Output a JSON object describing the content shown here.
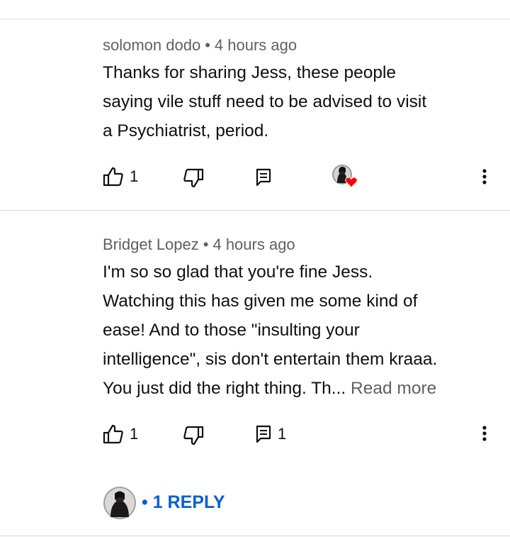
{
  "comments": [
    {
      "author": "solomon dodo",
      "separator": "•",
      "time": "4 hours ago",
      "lines": [
        "Thanks for sharing Jess, these people",
        "saying vile stuff need to be advised to visit",
        "a Psychiatrist, period."
      ],
      "likes": "1",
      "replies_count": ""
    },
    {
      "author": "Bridget Lopez",
      "separator": "•",
      "time": "4 hours ago",
      "lines": [
        "I'm so so glad that you're fine Jess.",
        "Watching this has given me some kind of",
        "ease! And to those \"insulting your",
        "intelligence\", sis don't entertain them kraaa.",
        "You just did the right thing. Th..."
      ],
      "read_more": "Read more",
      "likes": "1",
      "replies_count": "1"
    }
  ],
  "reply_link": "• 1 REPLY",
  "icons": {
    "like": "thumbs-up-icon",
    "dislike": "thumbs-down-icon",
    "reply": "reply-comment-icon",
    "more": "more-vert-icon",
    "heart": "creator-heart-icon"
  },
  "colors": {
    "link": "#065fd4",
    "meta": "#606060",
    "heart": "#ff0000"
  }
}
